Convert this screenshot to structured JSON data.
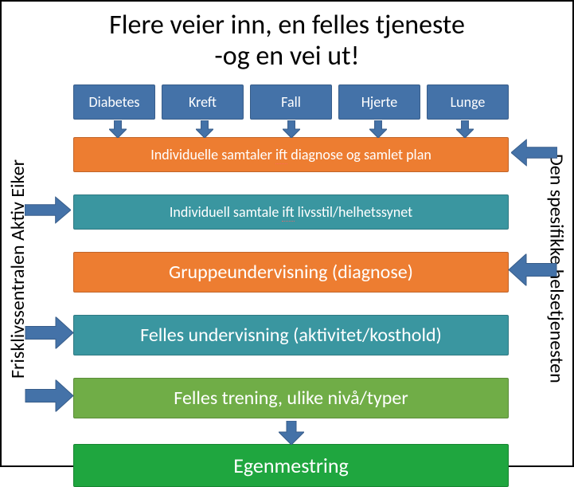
{
  "title_line1": "Flere veier inn, en felles tjeneste",
  "title_line2": "-og en vei ut!",
  "side_left": "Frisklivssentralen Aktiv Eiker",
  "side_right": "Den spesifikke helsetjenesten",
  "top_boxes": [
    "Diabetes",
    "Kreft",
    "Fall",
    "Hjerte",
    "Lunge"
  ],
  "bar1_pre": "Individuelle samtaler ",
  "bar1_ift": "ift",
  "bar1_post": " diagnose og samlet plan",
  "bar2_pre": "Individuell samtale ",
  "bar2_ift": "ift",
  "bar2_post": " livsstil/helhetssynet",
  "bar3": "Gruppeundervisning  (diagnose)",
  "bar4": "Felles undervisning  (aktivitet/kosthold)",
  "bar5": "Felles trening, ulike nivå/typer",
  "bar6": "Egenmestring",
  "colors": {
    "blue": "#4472a8",
    "orange": "#ed7d31",
    "teal": "#3a96a0",
    "olive": "#70ad47",
    "green": "#1fa63f",
    "arrow": "#4472a8"
  }
}
